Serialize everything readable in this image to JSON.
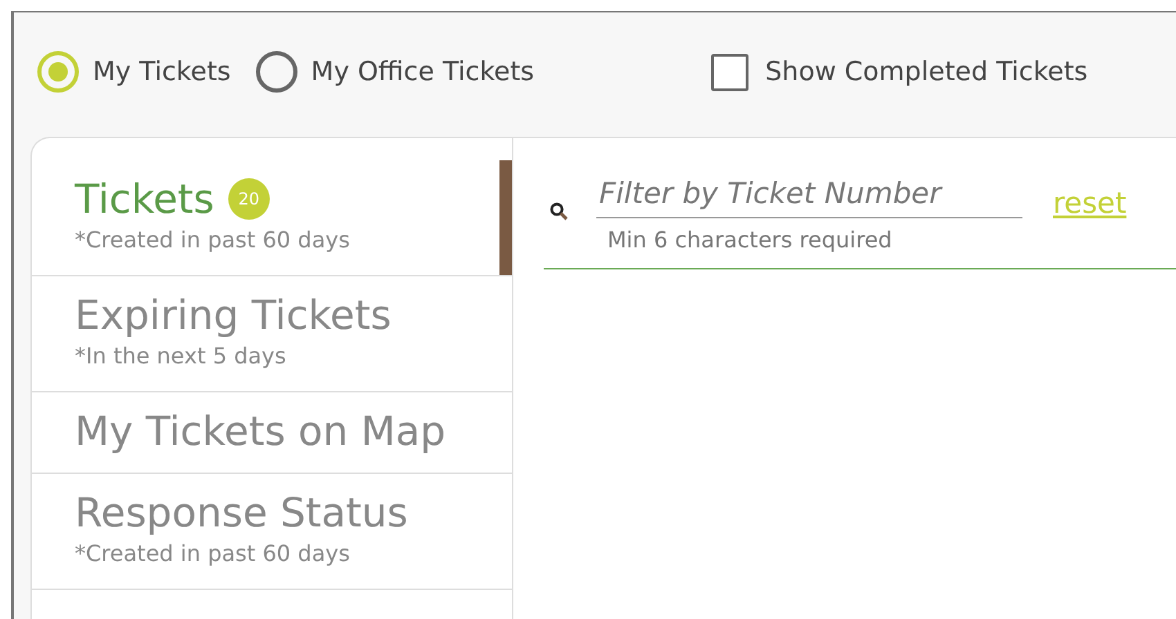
{
  "scope_options": [
    {
      "label": "My Tickets",
      "selected": true
    },
    {
      "label": "My Office Tickets",
      "selected": false
    }
  ],
  "show_completed": {
    "label": "Show Completed Tickets",
    "checked": false
  },
  "sidebar": {
    "items": [
      {
        "title": "Tickets",
        "badge": "20",
        "note": "*Created in past 60 days",
        "selected": true
      },
      {
        "title": "Expiring Tickets",
        "note": "*In the next 5 days",
        "selected": false
      },
      {
        "title": "My Tickets on Map",
        "selected": false
      },
      {
        "title": "Response Status",
        "note": "*Created in past 60 days",
        "selected": false
      }
    ]
  },
  "filter": {
    "placeholder": "Filter by Ticket Number",
    "hint": "Min 6 characters required",
    "reset": "reset"
  }
}
